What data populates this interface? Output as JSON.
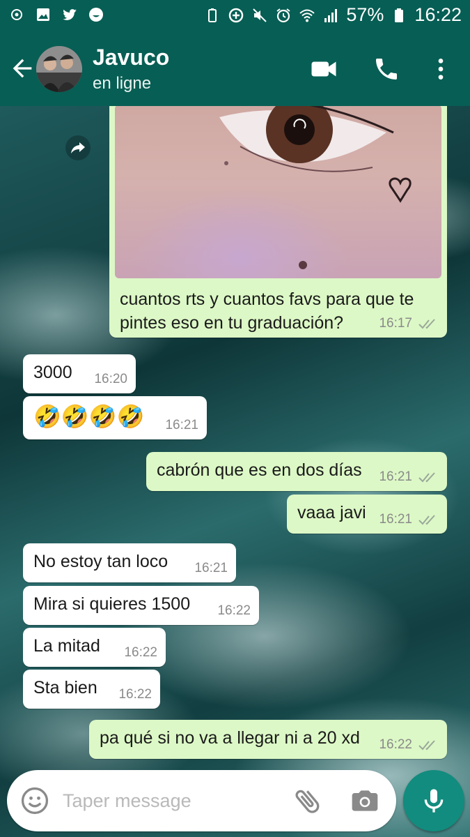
{
  "status_bar": {
    "battery": "57%",
    "time": "16:22",
    "left_icons": [
      "app-notification-icon",
      "gallery-icon",
      "twitter-icon",
      "smiley-icon"
    ],
    "right_icons": [
      "battery-saver-icon",
      "data-saver-icon",
      "mute-icon",
      "alarm-icon",
      "wifi-icon",
      "signal-icon",
      "battery-icon"
    ]
  },
  "header": {
    "contact_name": "Javuco",
    "status": "en ligne",
    "icons": [
      "back-arrow-icon",
      "video-call-icon",
      "phone-icon",
      "more-options-icon"
    ]
  },
  "colors": {
    "header": "#075e54",
    "outgoing_bubble": "#dcf8c6",
    "incoming_bubble": "#ffffff",
    "fab": "#128c7e"
  },
  "messages": [
    {
      "id": "m1",
      "direction": "out",
      "type": "image",
      "caption": "cuantos rts y cuantos favs para que te pintes eso en tu graduación?",
      "time": "16:17",
      "status": "read"
    },
    {
      "id": "m2",
      "direction": "in",
      "text": "3000",
      "time": "16:20"
    },
    {
      "id": "m3",
      "direction": "in",
      "text": "🤣🤣🤣🤣",
      "time": "16:21"
    },
    {
      "id": "m4",
      "direction": "out",
      "text": "cabrón que es en dos días",
      "time": "16:21",
      "status": "read"
    },
    {
      "id": "m5",
      "direction": "out",
      "text": "vaaa javi",
      "time": "16:21",
      "status": "read"
    },
    {
      "id": "m6",
      "direction": "in",
      "text": "No estoy tan loco",
      "time": "16:21"
    },
    {
      "id": "m7",
      "direction": "in",
      "text": "Mira si quieres 1500",
      "time": "16:22"
    },
    {
      "id": "m8",
      "direction": "in",
      "text": "La mitad",
      "time": "16:22"
    },
    {
      "id": "m9",
      "direction": "in",
      "text": "Sta bien",
      "time": "16:22"
    },
    {
      "id": "m10",
      "direction": "out",
      "text": "pa qué si no va a llegar ni a 20 xd",
      "time": "16:22",
      "status": "read"
    }
  ],
  "composer": {
    "placeholder": "Taper message",
    "icons": [
      "emoji-icon",
      "attach-icon",
      "camera-icon",
      "mic-icon"
    ]
  }
}
